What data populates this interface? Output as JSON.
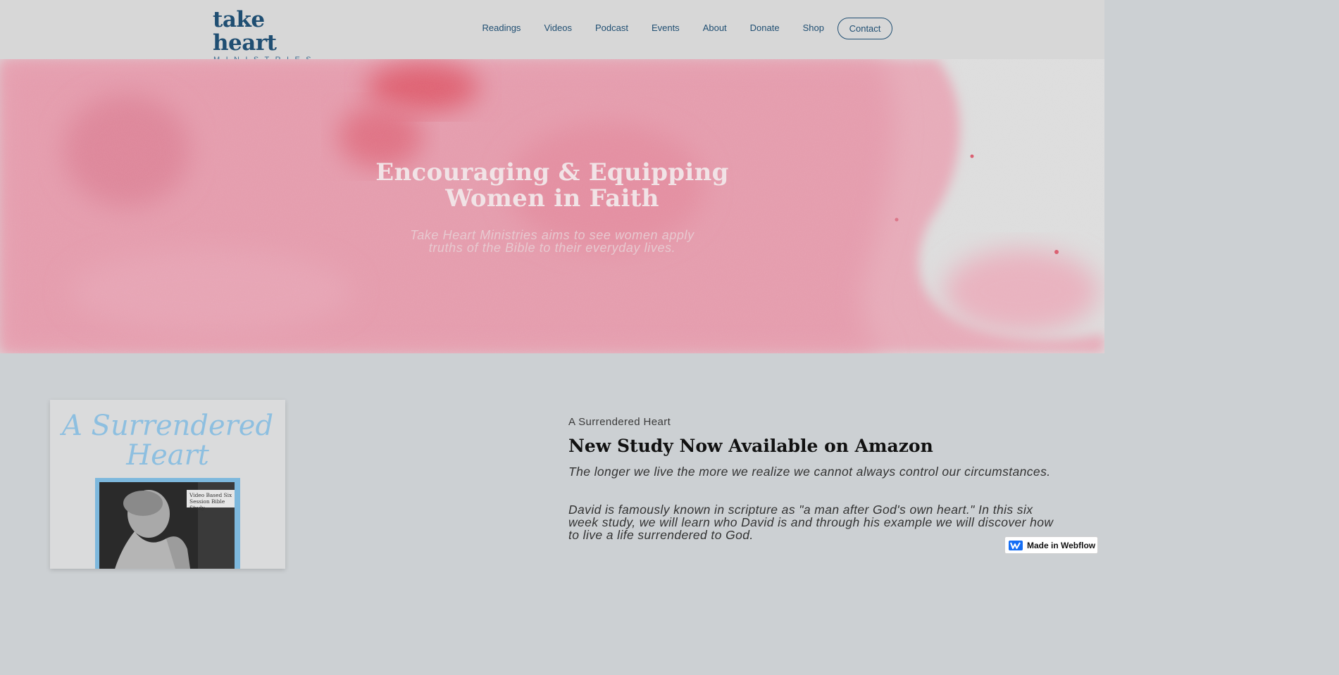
{
  "header": {
    "logo_main": "take heart",
    "logo_sub": "MINISTRIES",
    "nav": [
      "Readings",
      "Videos",
      "Podcast",
      "Events",
      "About",
      "Donate",
      "Shop"
    ],
    "contact_label": "Contact"
  },
  "hero": {
    "title_line1": "Encouraging & Equipping",
    "title_line2": "Women in Faith",
    "subtitle_line1": "Take Heart Ministries aims to see women apply",
    "subtitle_line2": "truths of the Bible to their everyday lives."
  },
  "feature": {
    "cover_title_line1": "A Surrendered",
    "cover_title_line2": "Heart",
    "cover_tag_line1": "Video Based Six",
    "cover_tag_line2": "Session Bible Study",
    "kicker": "A Surrendered Heart",
    "headline": "New Study Now Available on Amazon",
    "paragraph1": "The longer we live the more we realize we cannot always control our circumstances.",
    "paragraph2": "David is famously known in scripture as \"a man after God's own heart.\" In this six week study, we will learn who David is and through his example we will discover how to live a life surrendered to God."
  },
  "badge": {
    "label": "Made in Webflow"
  },
  "colors": {
    "brand_blue": "#1f4e72",
    "hero_pink": "#e8a3b2",
    "page_bg": "#ccd0d3",
    "cover_blue": "#8dbfe0"
  }
}
